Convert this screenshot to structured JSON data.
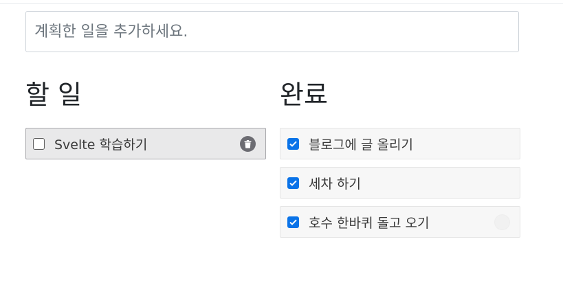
{
  "input": {
    "placeholder": "계획한 일을 추가하세요."
  },
  "todo_column": {
    "title": "할 일",
    "items": [
      {
        "label": "Svelte 학습하기",
        "checked": false
      }
    ]
  },
  "done_column": {
    "title": "완료",
    "items": [
      {
        "label": "블로그에 글 올리기",
        "checked": true
      },
      {
        "label": "세차 하기",
        "checked": true
      },
      {
        "label": "호수 한바퀴 돌고 오기",
        "checked": true
      }
    ]
  },
  "colors": {
    "checkbox_accent": "#0a73e8",
    "trash_icon": "#6c6c72"
  }
}
